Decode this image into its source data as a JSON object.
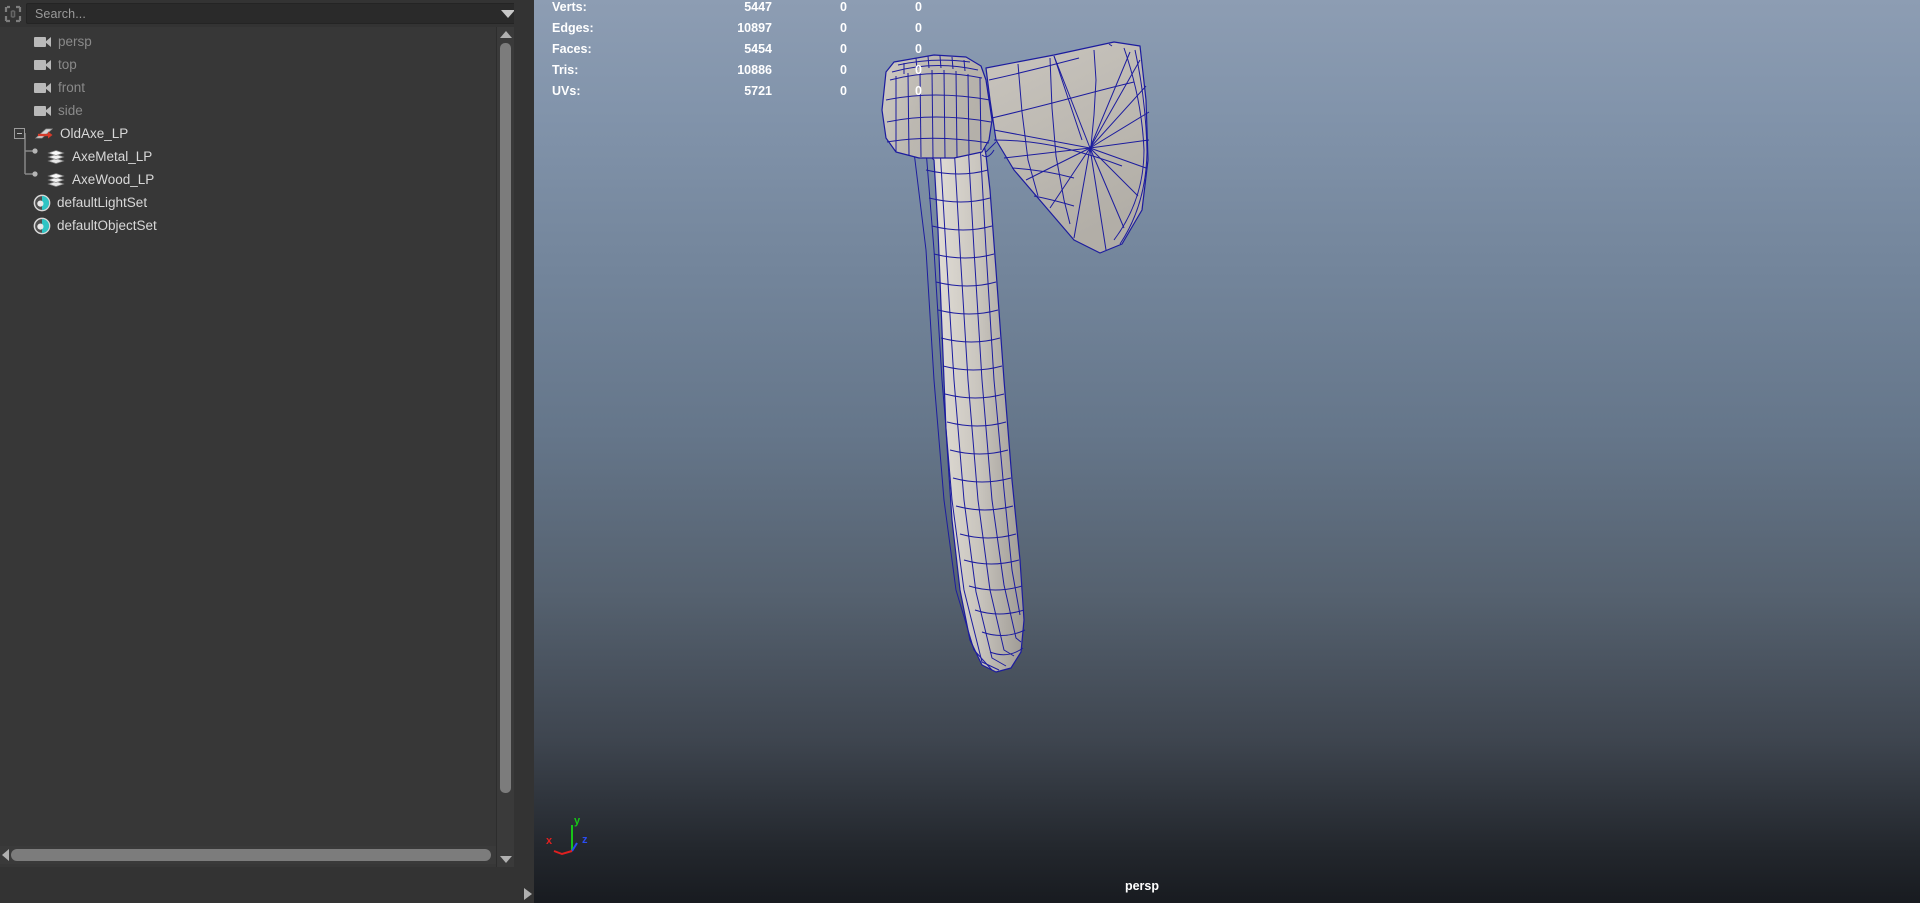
{
  "outliner": {
    "search": {
      "placeholder": "Search...",
      "icon": "outliner-toggle-icon",
      "dropdown_icon": "chevron-down-icon"
    },
    "items": [
      {
        "label": "persp",
        "type": "camera",
        "icon": "camera-icon",
        "depth": 1,
        "dim": true,
        "expandable": false
      },
      {
        "label": "top",
        "type": "camera",
        "icon": "camera-icon",
        "depth": 1,
        "dim": true,
        "expandable": false
      },
      {
        "label": "front",
        "type": "camera",
        "icon": "camera-icon",
        "depth": 1,
        "dim": true,
        "expandable": false
      },
      {
        "label": "side",
        "type": "camera",
        "icon": "camera-icon",
        "depth": 1,
        "dim": true,
        "expandable": false
      },
      {
        "label": "OldAxe_LP",
        "type": "transform",
        "icon": "transform-icon",
        "depth": 0,
        "dim": false,
        "expandable": true,
        "expanded": true
      },
      {
        "label": "AxeMetal_LP",
        "type": "mesh",
        "icon": "mesh-icon",
        "depth": 2,
        "dim": false,
        "expandable": false
      },
      {
        "label": "AxeWood_LP",
        "type": "mesh",
        "icon": "mesh-icon",
        "depth": 2,
        "dim": false,
        "expandable": false
      },
      {
        "label": "defaultLightSet",
        "type": "set",
        "icon": "set-icon",
        "depth": 1,
        "dim": false,
        "expandable": false
      },
      {
        "label": "defaultObjectSet",
        "type": "set",
        "icon": "set-icon",
        "depth": 1,
        "dim": false,
        "expandable": false
      }
    ],
    "scrollbars": {
      "vertical_up_icon": "triangle-up-icon",
      "vertical_down_icon": "triangle-down-icon",
      "horizontal_left_icon": "triangle-left-icon",
      "horizontal_right_icon": "triangle-right-icon"
    }
  },
  "viewport": {
    "camera_name": "persp",
    "heads_up_display": {
      "rows": [
        {
          "label": "Verts:",
          "total": "5447",
          "selected": "0",
          "other": "0"
        },
        {
          "label": "Edges:",
          "total": "10897",
          "selected": "0",
          "other": "0"
        },
        {
          "label": "Faces:",
          "total": "5454",
          "selected": "0",
          "other": "0"
        },
        {
          "label": "Tris:",
          "total": "10886",
          "selected": "0",
          "other": "0"
        },
        {
          "label": "UVs:",
          "total": "5721",
          "selected": "0",
          "other": "0"
        }
      ]
    },
    "axis_gizmo": {
      "x_label": "x",
      "y_label": "y",
      "z_label": "z",
      "x_color": "#e02020",
      "y_color": "#18c418",
      "z_color": "#2a4cf0"
    },
    "colors": {
      "background_top": "#8d9db3",
      "background_bottom": "#181b20",
      "wireframe": "#1a1a9c",
      "surface_light": "#d8d4cd",
      "surface_dark": "#a8a49d"
    }
  }
}
